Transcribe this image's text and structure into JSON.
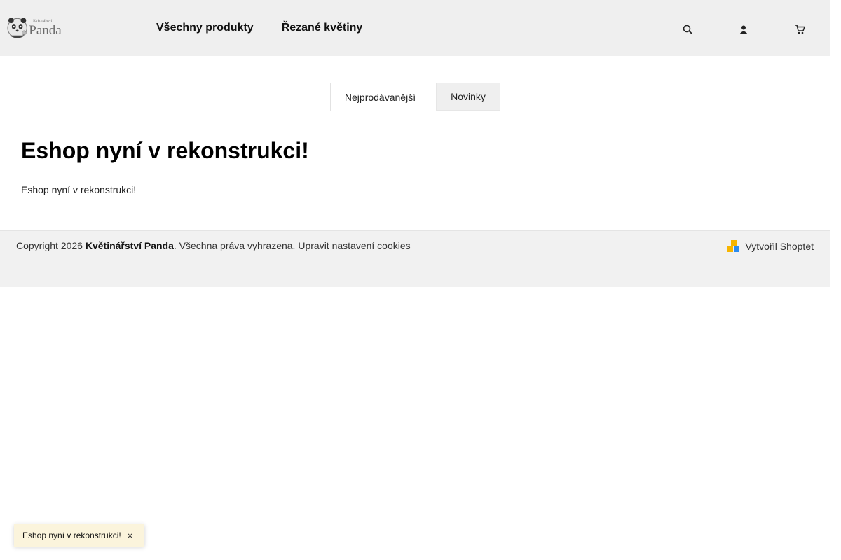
{
  "header": {
    "logo": {
      "small_text": "Květinářství",
      "big_text": "Panda"
    },
    "nav": [
      {
        "label": "Všechny produkty"
      },
      {
        "label": "Řezané květiny"
      }
    ],
    "icons": [
      "search-icon",
      "user-icon",
      "cart-icon"
    ]
  },
  "tabs": [
    {
      "label": "Nejprodávanější",
      "active": true
    },
    {
      "label": "Novinky",
      "active": false
    }
  ],
  "main": {
    "heading": "Eshop nyní v rekonstrukci!",
    "text": "Eshop nyní v rekonstrukci!"
  },
  "footer": {
    "copyright_prefix": "Copyright 2026",
    "brand": "Květinářství Panda",
    "rights": ". Všechna práva vyhrazena.",
    "cookies_link": "Upravit nastavení cookies",
    "created_by": "Vytvořil Shoptet"
  },
  "toast": {
    "text": "Eshop nyní v rekonstrukci!"
  },
  "colors": {
    "header_bg": "#efefef",
    "toast_bg": "#fbf4dc",
    "shoptet_yellow": "#f7b500",
    "shoptet_blue": "#2d8cf0"
  }
}
